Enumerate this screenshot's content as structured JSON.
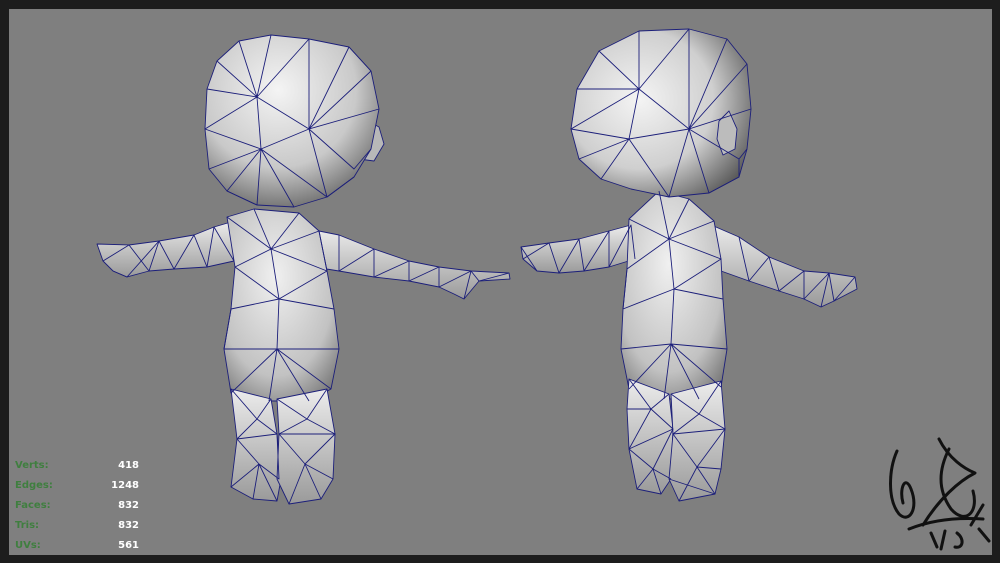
{
  "window": {
    "title": ""
  },
  "colors": {
    "background": "#7f7f7f",
    "frame": "#1d1d1d",
    "wireframe": "#1c1f7a",
    "stat_label": "#3f7f3f",
    "stat_value": "#ffffff"
  },
  "scene": {
    "models": [
      {
        "view": "front",
        "shading": "smooth-shaded-with-wireframe"
      },
      {
        "view": "back-three-quarter",
        "shading": "smooth-shaded-with-wireframe"
      }
    ]
  },
  "heads_up_display": {
    "poly_count": [
      {
        "label": "Verts:",
        "value": "418"
      },
      {
        "label": "Edges:",
        "value": "1248"
      },
      {
        "label": "Faces:",
        "value": "832"
      },
      {
        "label": "Tris:",
        "value": "832"
      },
      {
        "label": "UVs:",
        "value": "561"
      }
    ]
  },
  "signature": {
    "text": ""
  }
}
